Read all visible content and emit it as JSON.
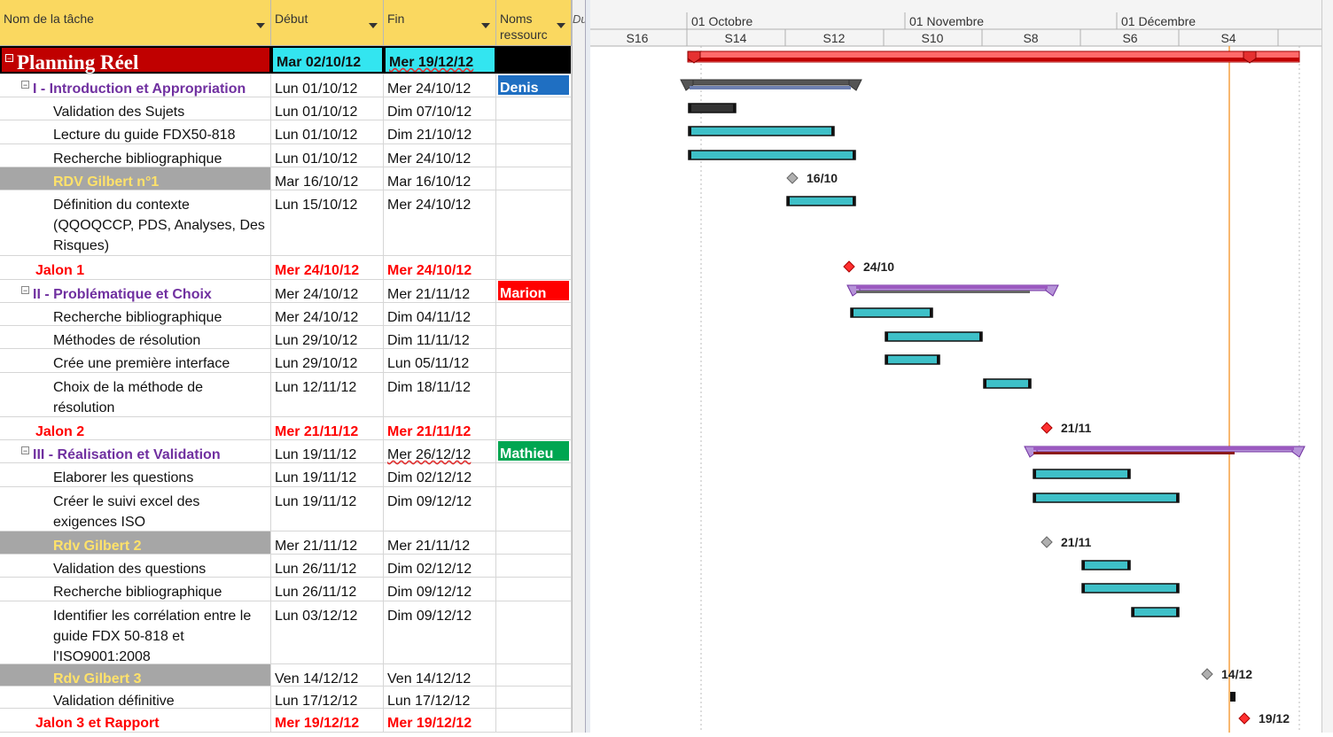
{
  "table": {
    "headers": {
      "name": "Nom de la tâche",
      "start": "Début",
      "end": "Fin",
      "resources": "Noms ressourc",
      "extra": "Du"
    },
    "rows": [
      {
        "name": "Planning Réel",
        "start": "Mar 02/10/12",
        "end": "Mer 19/12/12",
        "resource": "",
        "type": "project"
      },
      {
        "name": "I - Introduction et Appropriation",
        "start": "Lun 01/10/12",
        "end": "Mer 24/10/12",
        "resource": "Denis",
        "resource_color": "#1f6fc2",
        "type": "summary"
      },
      {
        "name": "Validation des Sujets",
        "start": "Lun 01/10/12",
        "end": "Dim 07/10/12",
        "resource": "",
        "type": "task"
      },
      {
        "name": "Lecture du guide FDX50-818",
        "start": "Lun 01/10/12",
        "end": "Dim 21/10/12",
        "resource": "",
        "type": "task"
      },
      {
        "name": "Recherche bibliographique",
        "start": "Lun 01/10/12",
        "end": "Mer 24/10/12",
        "resource": "",
        "type": "task"
      },
      {
        "name": "RDV Gilbert n°1",
        "start": "Mar 16/10/12",
        "end": "Mar 16/10/12",
        "resource": "",
        "type": "rdv"
      },
      {
        "name": "Définition du contexte (QQOQCCP, PDS, Analyses, Des Risques)",
        "start": "Lun 15/10/12",
        "end": "Mer 24/10/12",
        "resource": "",
        "type": "task"
      },
      {
        "name": "Jalon 1",
        "start": "Mer 24/10/12",
        "end": "Mer 24/10/12",
        "resource": "",
        "type": "milestone"
      },
      {
        "name": "II - Problématique et Choix",
        "start": "Mer 24/10/12",
        "end": "Mer 21/11/12",
        "resource": "Marion",
        "resource_color": "#ff0000",
        "type": "summary"
      },
      {
        "name": "Recherche bibliographique",
        "start": "Mer 24/10/12",
        "end": "Dim 04/11/12",
        "resource": "",
        "type": "task"
      },
      {
        "name": "Méthodes de résolution",
        "start": "Lun 29/10/12",
        "end": "Dim 11/11/12",
        "resource": "",
        "type": "task"
      },
      {
        "name": "Crée une première interface",
        "start": "Lun 29/10/12",
        "end": "Lun 05/11/12",
        "resource": "",
        "type": "task"
      },
      {
        "name": "Choix de la méthode de résolution",
        "start": "Lun 12/11/12",
        "end": "Dim 18/11/12",
        "resource": "",
        "type": "task"
      },
      {
        "name": "Jalon 2",
        "start": "Mer 21/11/12",
        "end": "Mer 21/11/12",
        "resource": "",
        "type": "milestone"
      },
      {
        "name": "III - Réalisation et Validation",
        "start": "Lun 19/11/12",
        "end": "Mer 26/12/12",
        "resource": "Mathieu",
        "resource_color": "#00a651",
        "type": "summary"
      },
      {
        "name": "Elaborer les questions",
        "start": "Lun 19/11/12",
        "end": "Dim 02/12/12",
        "resource": "",
        "type": "task"
      },
      {
        "name": "Créer le suivi excel des exigences ISO",
        "start": "Lun 19/11/12",
        "end": "Dim 09/12/12",
        "resource": "",
        "type": "task"
      },
      {
        "name": "Rdv Gilbert 2",
        "start": "Mer 21/11/12",
        "end": "Mer 21/11/12",
        "resource": "",
        "type": "rdv"
      },
      {
        "name": "Validation des questions",
        "start": "Lun 26/11/12",
        "end": "Dim 02/12/12",
        "resource": "",
        "type": "task"
      },
      {
        "name": "Recherche bibliographique",
        "start": "Lun 26/11/12",
        "end": "Dim 09/12/12",
        "resource": "",
        "type": "task"
      },
      {
        "name": "Identifier les corrélation entre le guide FDX 50-818 et l'ISO9001:2008",
        "start": "Lun 03/12/12",
        "end": "Dim 09/12/12",
        "resource": "",
        "type": "task"
      },
      {
        "name": "Rdv Gilbert 3",
        "start": "Ven 14/12/12",
        "end": "Ven 14/12/12",
        "resource": "",
        "type": "rdv"
      },
      {
        "name": "Validation définitive",
        "start": "Lun 17/12/12",
        "end": "Lun 17/12/12",
        "resource": "",
        "type": "task"
      },
      {
        "name": "Jalon 3 et Rapport",
        "start": "Mer 19/12/12",
        "end": "Mer 19/12/12",
        "resource": "",
        "type": "milestone"
      }
    ]
  },
  "timescale": {
    "months": [
      "01 Octobre",
      "01 Novembre",
      "01 Décembre"
    ],
    "weeks": [
      "S16",
      "S14",
      "S12",
      "S10",
      "S8",
      "S6",
      "S4"
    ]
  },
  "gantt_labels": [
    "16/10",
    "24/10",
    "21/11",
    "21/11",
    "14/12",
    "19/12"
  ],
  "colors": {
    "header": "#fad860",
    "task_bar": "#3ec0c8",
    "summary_bar": "#9b59c0",
    "project_bar": "#ff6a6a",
    "status_line": "#f5a040",
    "milestone_red": "#ff3030",
    "milestone_gray": "#b0b0b0"
  }
}
